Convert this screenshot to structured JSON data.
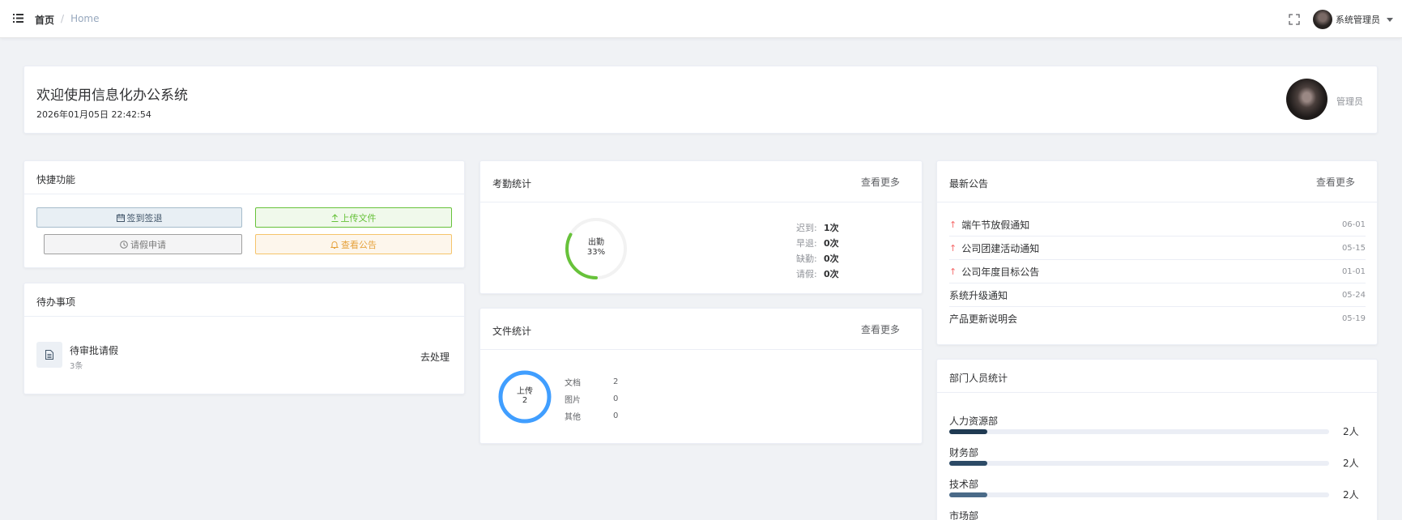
{
  "header": {
    "breadcrumb": [
      "首页",
      "Home"
    ],
    "breadcrumb_sep": "/",
    "user_name": "系统管理员"
  },
  "welcome": {
    "title": "欢迎使用信息化办公系统",
    "datetime": "2026年01月05日 22:42:54",
    "role": "管理员"
  },
  "quick": {
    "title": "快捷功能",
    "buttons": [
      {
        "label": "签到签退",
        "icon": "calendar-icon"
      },
      {
        "label": "上传文件",
        "icon": "upload-icon"
      },
      {
        "label": "请假申请",
        "icon": "clock-icon"
      },
      {
        "label": "查看公告",
        "icon": "bell-icon"
      }
    ]
  },
  "todo": {
    "title": "待办事项",
    "items": [
      {
        "title": "待审批请假",
        "count": "3条",
        "action": "去处理"
      }
    ]
  },
  "attendance": {
    "title": "考勤统计",
    "more": "查看更多",
    "ring_label": "出勤",
    "ring_percent": "33%",
    "ring_value": 0.33,
    "stats": [
      {
        "label": "迟到:",
        "value": "1次"
      },
      {
        "label": "早退:",
        "value": "0次"
      },
      {
        "label": "缺勤:",
        "value": "0次"
      },
      {
        "label": "请假:",
        "value": "0次"
      }
    ]
  },
  "files": {
    "title": "文件统计",
    "more": "查看更多",
    "ring_label": "上传",
    "ring_total": "2",
    "stats": [
      {
        "label": "文档",
        "value": "2"
      },
      {
        "label": "图片",
        "value": "0"
      },
      {
        "label": "其他",
        "value": "0"
      }
    ]
  },
  "notices": {
    "title": "最新公告",
    "more": "查看更多",
    "items": [
      {
        "title": "端午节放假通知",
        "date": "06-01",
        "pinned": true
      },
      {
        "title": "公司团建活动通知",
        "date": "05-15",
        "pinned": true
      },
      {
        "title": "公司年度目标公告",
        "date": "01-01",
        "pinned": true
      },
      {
        "title": "系统升级通知",
        "date": "05-24",
        "pinned": false
      },
      {
        "title": "产品更新说明会",
        "date": "05-19",
        "pinned": false
      }
    ]
  },
  "departments": {
    "title": "部门人员统计",
    "items": [
      {
        "name": "人力资源部",
        "count": "2人",
        "ratio": 0.1,
        "color": "#1f3a52"
      },
      {
        "name": "财务部",
        "count": "2人",
        "ratio": 0.1,
        "color": "#2c4a66"
      },
      {
        "name": "技术部",
        "count": "2人",
        "ratio": 0.1,
        "color": "#4a6a88"
      },
      {
        "name": "市场部",
        "count": "",
        "ratio": 0,
        "color": "#4a6a88"
      }
    ]
  },
  "colors": {
    "attendance_ring": "#67c23a",
    "file_ring": "#409eff",
    "notice_arrow": "#f56c6c"
  }
}
